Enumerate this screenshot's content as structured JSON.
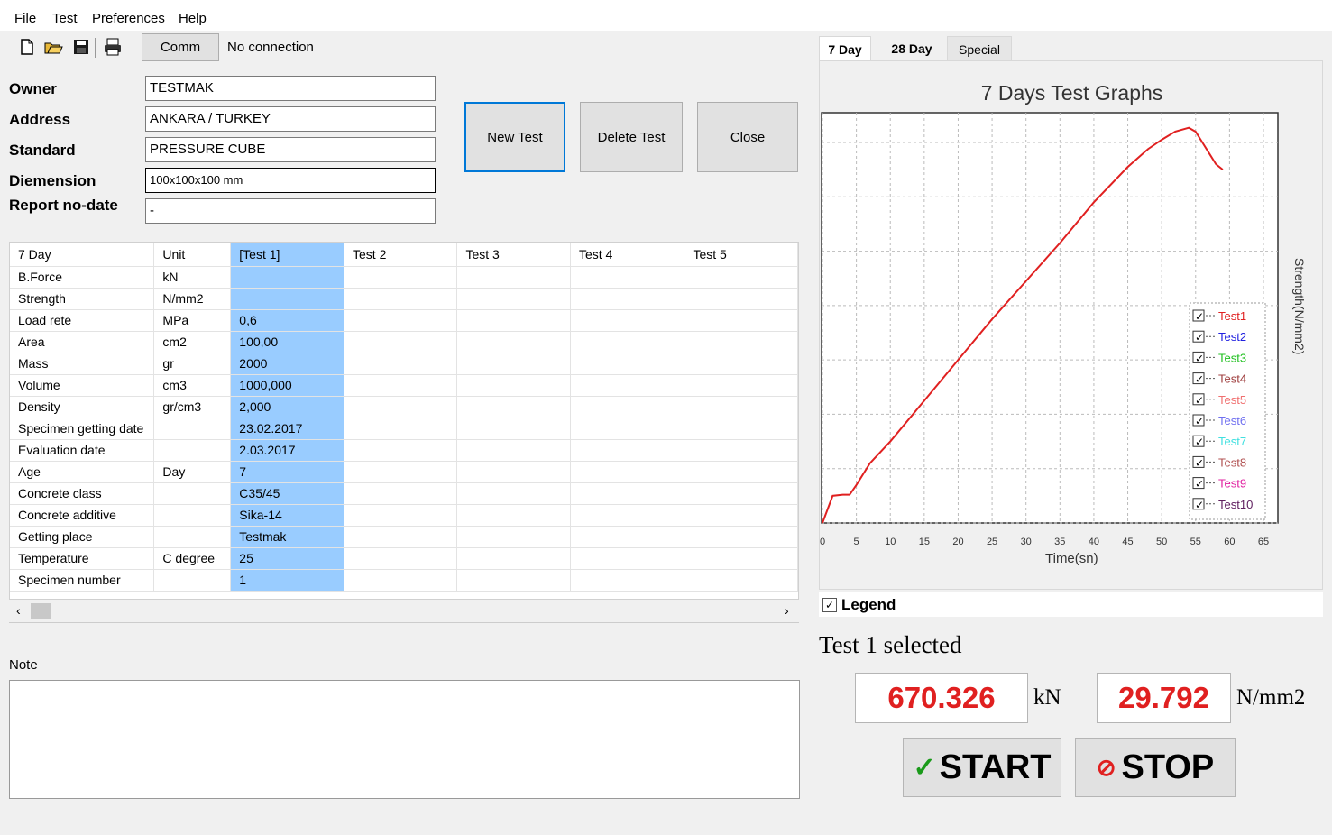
{
  "menu": [
    "File",
    "Test",
    "Preferences",
    "Help"
  ],
  "toolbar": {
    "icons": [
      "new-file-icon",
      "open-folder-icon",
      "save-icon",
      "print-icon"
    ],
    "comm_label": "Comm",
    "connection_status": "No connection"
  },
  "form": {
    "owner_label": "Owner",
    "owner_value": "TESTMAK",
    "address_label": "Address",
    "address_value": "ANKARA / TURKEY",
    "standard_label": "Standard",
    "standard_value": "PRESSURE CUBE",
    "dimension_label": "Diemension",
    "dimension_value": "100x100x100 mm",
    "report_label": "Report no-date",
    "report_value": "-"
  },
  "actions": {
    "new_test": "New Test",
    "delete_test": "Delete Test",
    "close": "Close"
  },
  "table": {
    "columns": [
      "7 Day",
      "Unit",
      "[Test 1]",
      "Test 2",
      "Test 3",
      "Test 4",
      "Test 5"
    ],
    "rows": [
      [
        "B.Force",
        "kN",
        ""
      ],
      [
        "Strength",
        "N/mm2",
        ""
      ],
      [
        "Load rete",
        "MPa",
        "0,6"
      ],
      [
        "Area",
        "cm2",
        "100,00"
      ],
      [
        "Mass",
        "gr",
        "2000"
      ],
      [
        "Volume",
        "cm3",
        "1000,000"
      ],
      [
        "Density",
        "gr/cm3",
        "2,000"
      ],
      [
        "Specimen getting date",
        "",
        "23.02.2017"
      ],
      [
        "Evaluation date",
        "",
        "2.03.2017"
      ],
      [
        "Age",
        "Day",
        "7"
      ],
      [
        "Concrete class",
        "",
        "C35/45"
      ],
      [
        "Concrete additive",
        "",
        "Sika-14"
      ],
      [
        "Getting place",
        "",
        "Testmak"
      ],
      [
        "Temperature",
        "C degree",
        "25"
      ],
      [
        "Specimen number",
        "",
        "1"
      ]
    ]
  },
  "note_label": "Note",
  "tabs": [
    "7 Day",
    "28 Day",
    "Special"
  ],
  "legend_checkbox_label": "Legend",
  "selection_text": "Test 1 selected",
  "readouts": {
    "force": "670.326",
    "force_unit": "kN",
    "strength": "29.792",
    "strength_unit": "N/mm2"
  },
  "controls": {
    "start": "START",
    "stop": "STOP"
  },
  "colors": {
    "selected_cell": "#99ccff",
    "readout": "#e02020",
    "test1_line": "#e03030"
  },
  "chart_data": {
    "type": "line",
    "title": "7 Days Test Graphs",
    "xlabel": "Time(sn)",
    "ylabel": "Strength(N/mm2)",
    "xlim": [
      0,
      65
    ],
    "ylim": [
      0,
      700
    ],
    "xticks": [
      "0",
      "5",
      "10",
      "15",
      "20",
      "25",
      "30",
      "35",
      "40",
      "45",
      "50",
      "55",
      "60",
      "65"
    ],
    "yticks": [
      "0",
      "100",
      "200",
      "300",
      "400",
      "500",
      "600",
      "700"
    ],
    "grid": true,
    "legend_position": "right",
    "legend": [
      {
        "name": "Test1",
        "color": "#e02020"
      },
      {
        "name": "Test2",
        "color": "#2020e0"
      },
      {
        "name": "Test3",
        "color": "#20c020"
      },
      {
        "name": "Test4",
        "color": "#a04040"
      },
      {
        "name": "Test5",
        "color": "#f07070"
      },
      {
        "name": "Test6",
        "color": "#7070f0"
      },
      {
        "name": "Test7",
        "color": "#40e0e0"
      },
      {
        "name": "Test8",
        "color": "#b05050"
      },
      {
        "name": "Test9",
        "color": "#e020a0"
      },
      {
        "name": "Test10",
        "color": "#602060"
      }
    ],
    "series": [
      {
        "name": "Test1",
        "x": [
          0,
          1.5,
          3,
          4,
          5,
          7,
          10,
          15,
          20,
          25,
          30,
          35,
          40,
          45,
          48,
          50,
          52,
          54,
          55,
          56,
          57,
          58,
          59
        ],
        "y": [
          0,
          50,
          52,
          52,
          70,
          110,
          150,
          225,
          300,
          375,
          445,
          515,
          590,
          655,
          688,
          705,
          720,
          727,
          720,
          700,
          680,
          660,
          650
        ]
      }
    ]
  }
}
